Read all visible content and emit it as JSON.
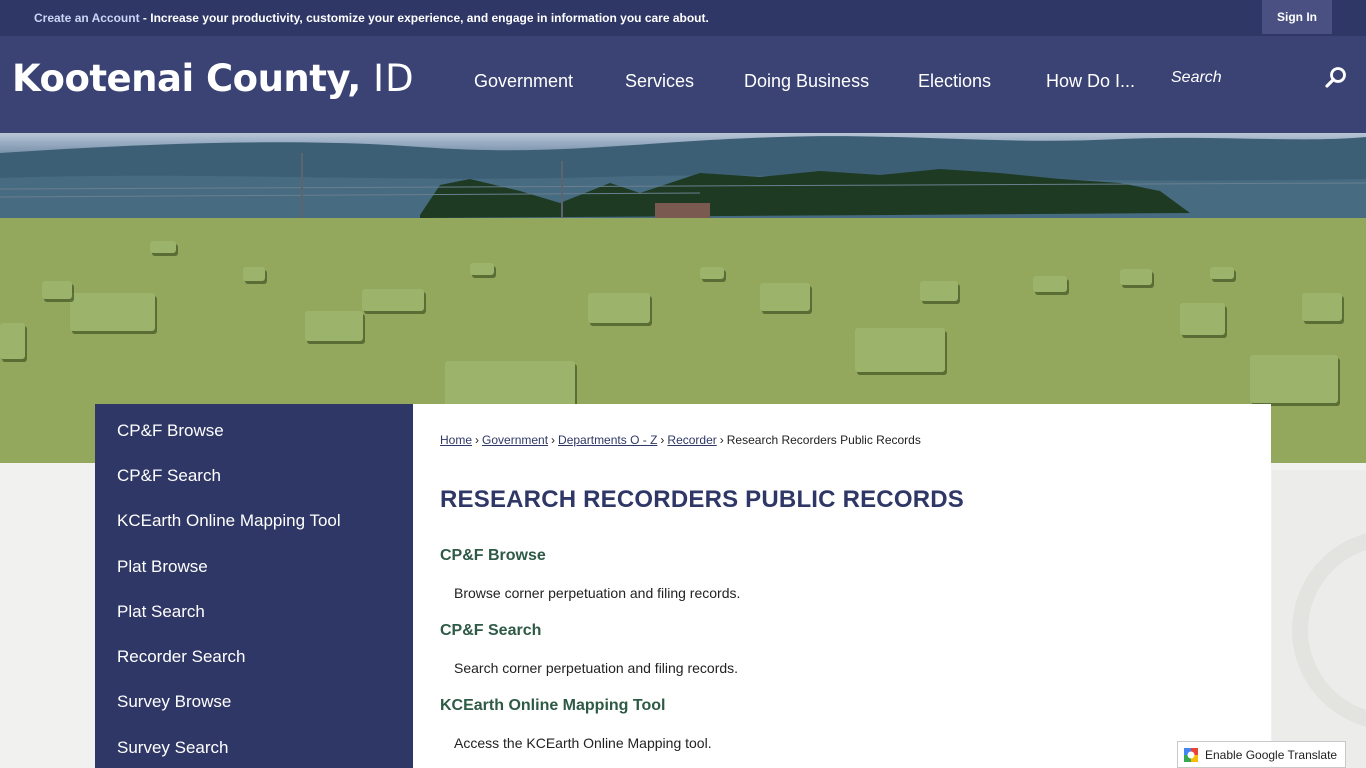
{
  "top_bar": {
    "create_account_link": "Create an Account",
    "promo_text": " - Increase your productivity, customize your experience, and engage in information you care about.",
    "sign_in_label": "Sign In"
  },
  "header": {
    "logo_name": "Kootenai County,",
    "logo_state": "ID",
    "nav": [
      {
        "label": "Government"
      },
      {
        "label": "Services"
      },
      {
        "label": "Doing Business"
      },
      {
        "label": "Elections"
      },
      {
        "label": "How Do I..."
      }
    ],
    "search_placeholder": "Search",
    "search_icon": "magnifier-icon"
  },
  "sidebar": {
    "items": [
      {
        "label": "CP&F Browse"
      },
      {
        "label": "CP&F Search"
      },
      {
        "label": "KCEarth Online Mapping Tool"
      },
      {
        "label": "Plat Browse"
      },
      {
        "label": "Plat Search"
      },
      {
        "label": "Recorder Search"
      },
      {
        "label": "Survey Browse"
      },
      {
        "label": "Survey Search"
      }
    ]
  },
  "breadcrumb": {
    "links": [
      "Home",
      "Government",
      "Departments O - Z",
      "Recorder"
    ],
    "current": "Research Recorders Public Records",
    "separator": "›"
  },
  "main": {
    "title": "RESEARCH RECORDERS PUBLIC RECORDS",
    "sections": [
      {
        "title": "CP&F Browse",
        "description": "Browse corner perpetuation and filing records."
      },
      {
        "title": "CP&F Search",
        "description": "Search corner perpetuation and filing records."
      },
      {
        "title": "KCEarth Online Mapping Tool",
        "description": "Access the KCEarth Online Mapping tool."
      }
    ]
  },
  "translate_widget": {
    "label": "Enable Google Translate",
    "icon": "google-translate-icon"
  },
  "colors": {
    "navy": "#2f3766",
    "header": "#3a4373",
    "section_green": "#2e5a46"
  }
}
